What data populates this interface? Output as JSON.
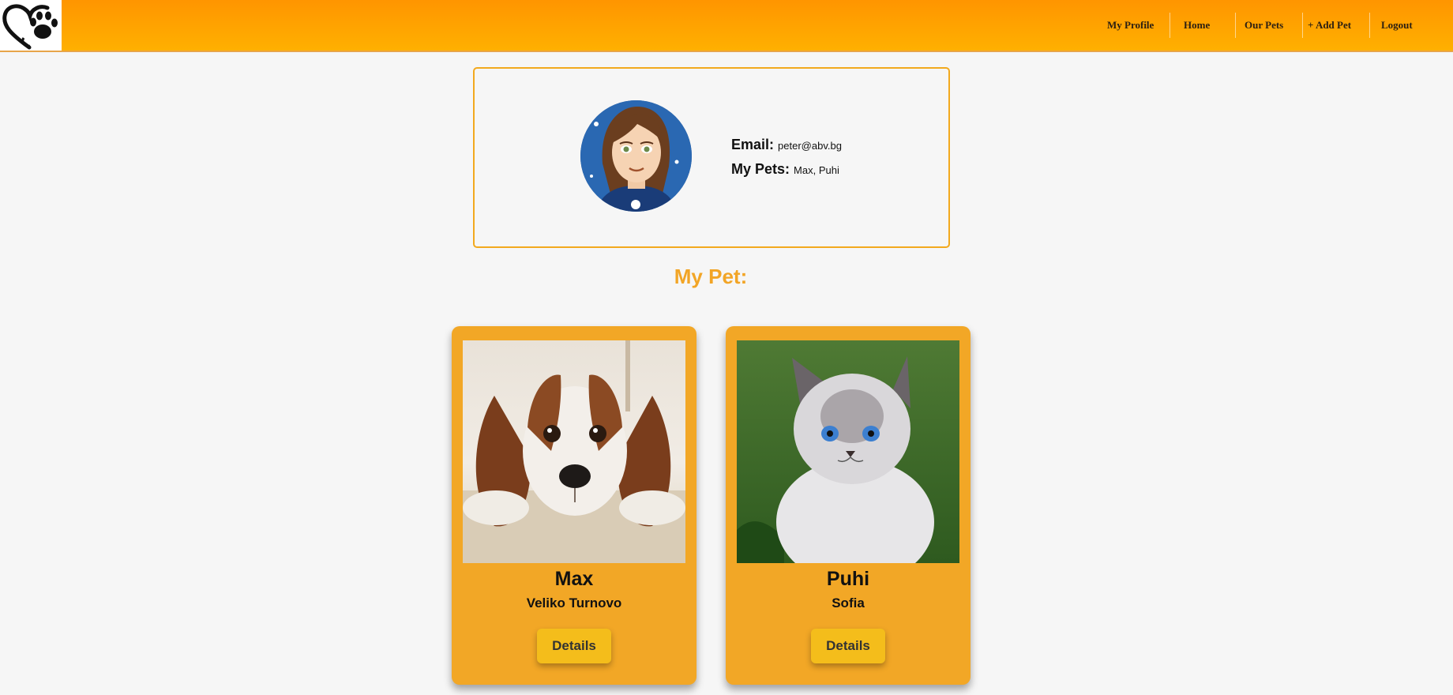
{
  "header": {
    "logo_icon": "heart-paw-icon",
    "nav": [
      {
        "label": "My Profile"
      },
      {
        "label": "Home"
      },
      {
        "label": "Our Pets"
      },
      {
        "label": "+ Add Pet"
      },
      {
        "label": "Logout"
      }
    ]
  },
  "profile": {
    "avatar_icon": "user-avatar",
    "email_label": "Email:",
    "email_value": "peter@abv.bg",
    "pets_label": "My Pets:",
    "pets_value": "Max, Puhi"
  },
  "section_title": "My Pet:",
  "pets": [
    {
      "name": "Max",
      "city": "Veliko Turnovo",
      "button": "Details",
      "photo": "dog-photo"
    },
    {
      "name": "Puhi",
      "city": "Sofia",
      "button": "Details",
      "photo": "cat-photo"
    }
  ],
  "colors": {
    "accent": "#f2a726",
    "header_top": "#ff9500",
    "header_bottom": "#ffb000",
    "button": "#f4bd1b",
    "background": "#f6f6f6"
  }
}
